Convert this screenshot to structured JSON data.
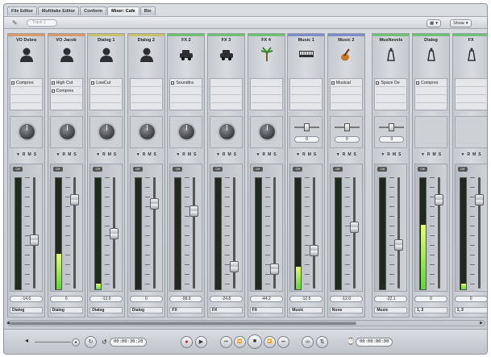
{
  "tabs": [
    "File Editor",
    "Multitake Editor",
    "Conform",
    "Mixer: Cafe",
    "Bin"
  ],
  "active_tab": 3,
  "toolbar": {
    "track_field_placeholder": "Track 1",
    "view_menu": "▦",
    "show_menu": "Show"
  },
  "strips": [
    {
      "name": "VO Debra",
      "color": "#d89a6a",
      "icon": "person-icon",
      "inserts": [
        "Compres"
      ],
      "control": "knob",
      "meter": 0,
      "fader": 0.57,
      "volume": "-14.6",
      "output": "Dialog"
    },
    {
      "name": "VO Jacob",
      "color": "#d89a6a",
      "icon": "person-icon",
      "inserts": [
        "High Cut",
        "Compres"
      ],
      "control": "knob",
      "meter": 0.32,
      "fader": 0.17,
      "volume": "0",
      "output": "Dialog"
    },
    {
      "name": "Dialog 1",
      "color": "#c6c26a",
      "icon": "person-icon",
      "inserts": [
        "LowCut"
      ],
      "control": "knob",
      "meter": 0.05,
      "fader": 0.51,
      "volume": "-12.0",
      "output": "Dialog"
    },
    {
      "name": "Dialog 2",
      "color": "#c6c26a",
      "icon": "person-icon",
      "inserts": [],
      "control": "knob",
      "meter": 0,
      "fader": 0.21,
      "volume": "0",
      "output": "Dialog"
    },
    {
      "name": "FX 2",
      "color": "#6fbf75",
      "icon": "car-icon",
      "inserts": [
        "Soundtra"
      ],
      "control": "knob",
      "meter": 0,
      "fader": 0.28,
      "volume": "-99.9",
      "output": "FX"
    },
    {
      "name": "FX 3",
      "color": "#6fbf75",
      "icon": "car-icon",
      "inserts": [],
      "control": "knob",
      "meter": 0,
      "fader": 0.84,
      "volume": "-24.8",
      "output": "FX"
    },
    {
      "name": "FX 4",
      "color": "#6fbf75",
      "icon": "palm-tree-icon",
      "inserts": [],
      "control": "knob",
      "meter": 0,
      "fader": 0.86,
      "volume": "-44.2",
      "output": "FX"
    },
    {
      "name": "Music 1",
      "color": "#7b8cc8",
      "icon": "keyboard-icon",
      "inserts": [],
      "control": "pan",
      "pan": "0",
      "meter": 0.2,
      "fader": 0.68,
      "volume": "-12.5",
      "output": "Music"
    },
    {
      "name": "Music 2",
      "color": "#7b8cc8",
      "icon": "guitar-icon",
      "inserts": [
        "Musical"
      ],
      "control": "pan",
      "pan": "0",
      "meter": 0,
      "fader": 0.44,
      "volume": "-12.0",
      "output": "None"
    },
    {
      "name": "MusNevels",
      "color": "#6fbf75",
      "icon": "output-icon",
      "inserts": [
        "Space De"
      ],
      "control": "pan",
      "pan": "0",
      "meter": 0,
      "fader": 0.62,
      "volume": "-22.1",
      "output": "Music"
    },
    {
      "name": "Dialog",
      "color": "#6fbf75",
      "icon": "output-icon",
      "inserts": [
        "Compres"
      ],
      "control": "none",
      "meter": 0.58,
      "fader": 0.17,
      "volume": "0",
      "output": "1, 2"
    },
    {
      "name": "FX",
      "color": "#6fbf75",
      "icon": "output-icon",
      "inserts": [],
      "control": "none",
      "meter": 0.05,
      "fader": 0.17,
      "volume": "0",
      "output": "1, 2"
    }
  ],
  "strip_buttons": [
    "▼",
    "R",
    "M",
    "S"
  ],
  "auto_label": "Off",
  "transport": {
    "current_timecode": "00:00:30:20",
    "duration_timecode": "00:00:00:00",
    "buttons": [
      "record",
      "play",
      "go-to-start",
      "rewind",
      "stop",
      "forward",
      "go-to-end",
      "loop",
      "cycle"
    ]
  }
}
